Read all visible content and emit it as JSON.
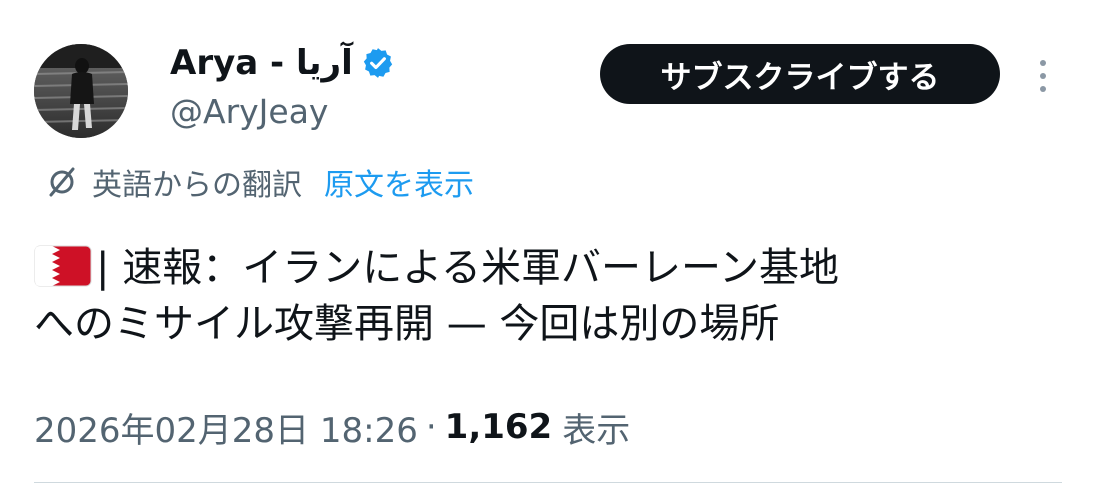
{
  "tweet": {
    "author": {
      "display_name": "Arya - آریا",
      "handle": "@AryJeay",
      "verified": true,
      "verified_color": "#1d9bf0"
    },
    "subscribe_label": "サブスクライブする",
    "more_icon": "more-vertical-icon",
    "translation": {
      "icon": "translate-icon",
      "translated_from": "英語からの翻訳",
      "show_original": "原文を表示",
      "link_color": "#1d9bf0"
    },
    "text": {
      "flag": "bahrain-flag",
      "line1": "| 速報：イランによる米軍バーレーン基地",
      "line2": "へのミサイル攻撃再開 — 今回は別の場所"
    },
    "meta": {
      "timestamp": "2026年02月28日 18:26",
      "separator": "·",
      "views_count": "1,162",
      "views_label": "表示"
    }
  }
}
